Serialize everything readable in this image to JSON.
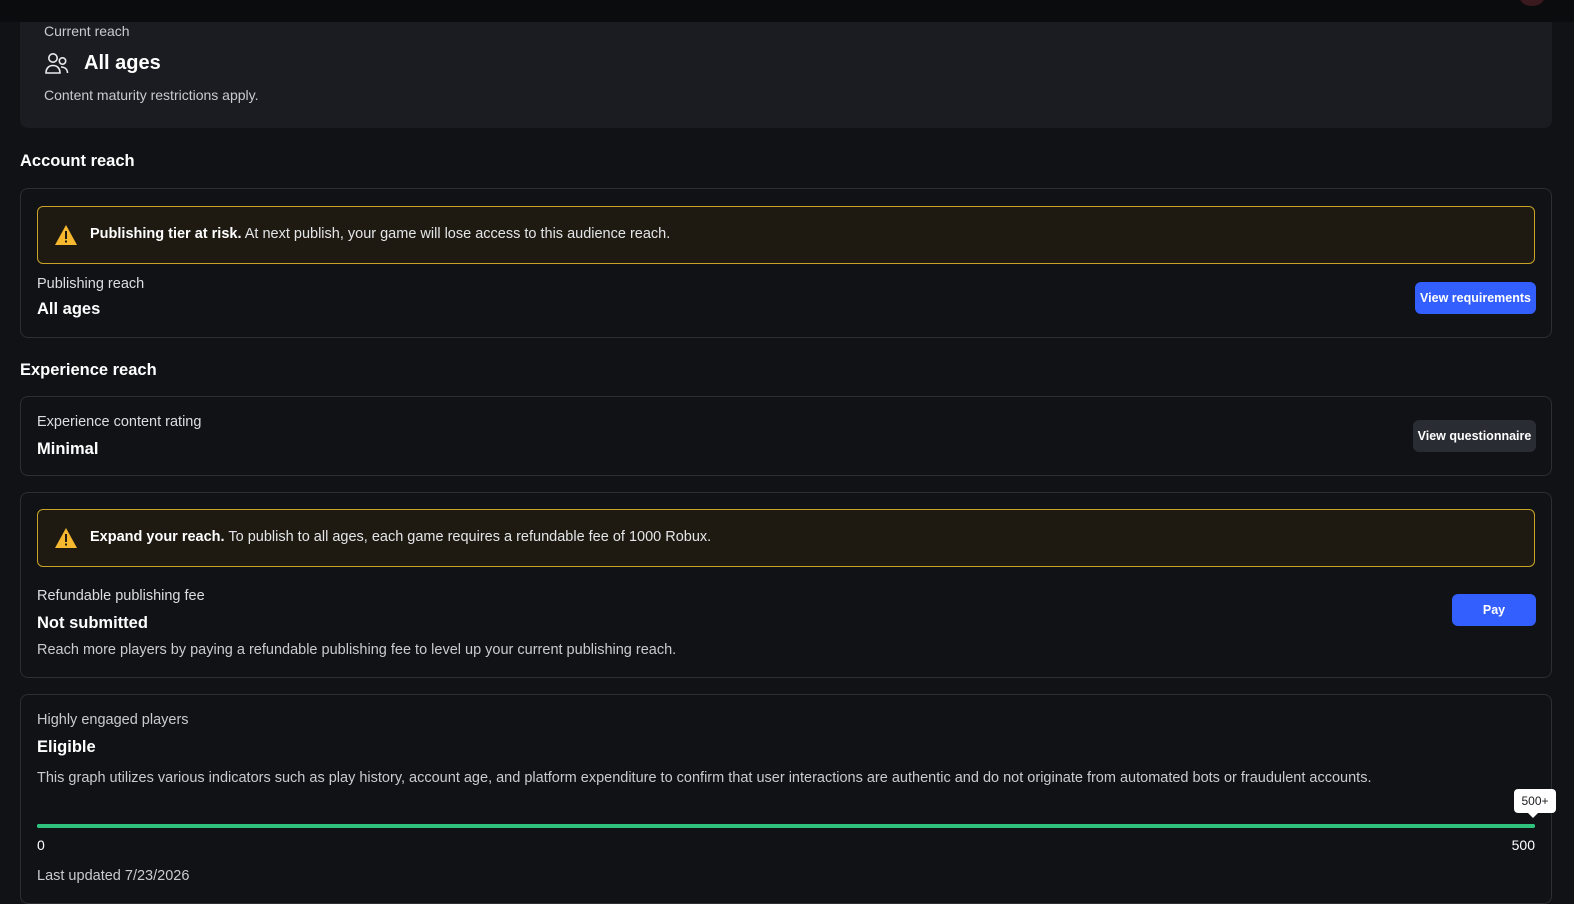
{
  "current_reach": {
    "label": "Current reach",
    "icon": "users-icon",
    "title": "All ages",
    "description": "Content maturity restrictions apply."
  },
  "account_reach": {
    "heading": "Account reach",
    "alert": {
      "icon": "warning-icon",
      "bold": "Publishing tier at risk.",
      "text": " At next publish, your game will lose access to this audience reach."
    },
    "label": "Publishing reach",
    "value": "All ages",
    "button_label": "View requirements"
  },
  "experience_reach": {
    "heading": "Experience reach",
    "rating": {
      "label": "Experience content rating",
      "value": "Minimal",
      "button_label": "View questionnaire"
    },
    "fee": {
      "alert": {
        "icon": "warning-icon",
        "bold": "Expand your reach.",
        "text": " To publish to all ages, each game requires a refundable fee of 1000 Robux."
      },
      "label": "Refundable publishing fee",
      "value": "Not submitted",
      "description": "Reach more players by paying a refundable publishing fee to level up your current publishing reach.",
      "button_label": "Pay"
    },
    "engaged": {
      "label": "Highly engaged players",
      "value": "Eligible",
      "description": "This graph utilizes various indicators such as play history, account age, and platform expenditure to confirm that user interactions are authentic and do not originate from automated bots or fraudulent accounts.",
      "progress": {
        "min": "0",
        "max": "500",
        "tooltip": "500+",
        "fraction": 1.0,
        "color": "#2ec27e"
      },
      "last_updated": "Last updated 7/23/2026"
    }
  },
  "colors": {
    "accent": "#335fff",
    "warning_border": "#c9a227",
    "warning_icon": "#f5b82e",
    "progress": "#2ec27e"
  }
}
